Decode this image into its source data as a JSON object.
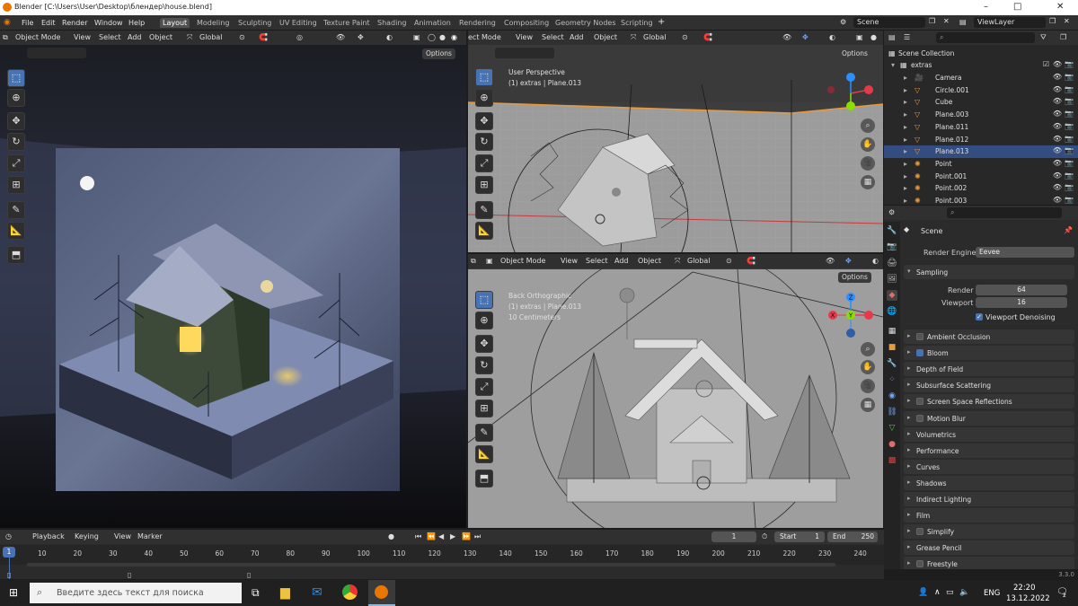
{
  "window": {
    "title": "Blender [C:\\Users\\User\\Desktop\\блендер\\house.blend]",
    "controls": [
      "–",
      "□",
      "✕"
    ]
  },
  "menu": [
    "File",
    "Edit",
    "Render",
    "Window",
    "Help"
  ],
  "workspaces": [
    "Layout",
    "Modeling",
    "Sculpting",
    "UV Editing",
    "Texture Paint",
    "Shading",
    "Animation",
    "Rendering",
    "Compositing",
    "Geometry Nodes",
    "Scripting"
  ],
  "active_workspace": "Layout",
  "scene_field": "Scene",
  "viewlayer_field": "ViewLayer",
  "viewport_menu": {
    "mode": "Object Mode",
    "items": [
      "View",
      "Select",
      "Add",
      "Object"
    ],
    "transform": "Global",
    "options": "Options"
  },
  "viewport_tr": {
    "mode_cut": "ect Mode",
    "view_name": "User Perspective",
    "collection": "(1) extras | Plane.013"
  },
  "viewport_br": {
    "view_name": "Back Orthographic",
    "collection": "(1) extras | Plane.013",
    "scale": "10 Centimeters"
  },
  "gizmo_axes": {
    "x": "X",
    "y": "Y",
    "z": "Z"
  },
  "colors": {
    "accent": "#4772b3",
    "x_axis": "#e8394b",
    "y_axis": "#8bdc00",
    "z_axis": "#2c8fff",
    "select": "#334d80",
    "object_orange": "#e89a3c",
    "data_green": "#58c452"
  },
  "outliner": {
    "root": "Scene Collection",
    "collection": "extras",
    "items": [
      {
        "name": "Camera",
        "icon": "camera-icon",
        "selected": false
      },
      {
        "name": "Circle.001",
        "icon": "mesh-icon",
        "selected": false
      },
      {
        "name": "Cube",
        "icon": "mesh-icon",
        "selected": false
      },
      {
        "name": "Plane.003",
        "icon": "mesh-icon",
        "selected": false
      },
      {
        "name": "Plane.011",
        "icon": "mesh-icon",
        "selected": false
      },
      {
        "name": "Plane.012",
        "icon": "mesh-icon",
        "selected": false
      },
      {
        "name": "Plane.013",
        "icon": "mesh-icon",
        "selected": true
      },
      {
        "name": "Point",
        "icon": "light-icon",
        "selected": false
      },
      {
        "name": "Point.001",
        "icon": "light-icon",
        "selected": false
      },
      {
        "name": "Point.002",
        "icon": "light-icon",
        "selected": false
      },
      {
        "name": "Point.003",
        "icon": "light-icon",
        "selected": false
      }
    ]
  },
  "properties": {
    "context": "Scene",
    "render_engine_label": "Render Engine",
    "render_engine_value": "Eevee",
    "sampling": {
      "title": "Sampling",
      "render_label": "Render",
      "render_value": "64",
      "viewport_label": "Viewport",
      "viewport_value": "16",
      "denoise_label": "Viewport Denoising",
      "denoise_on": true
    },
    "panels": [
      {
        "name": "Ambient Occlusion",
        "checkbox": true,
        "on": false
      },
      {
        "name": "Bloom",
        "checkbox": true,
        "on": true
      },
      {
        "name": "Depth of Field",
        "checkbox": false,
        "on": false
      },
      {
        "name": "Subsurface Scattering",
        "checkbox": false,
        "on": false
      },
      {
        "name": "Screen Space Reflections",
        "checkbox": true,
        "on": false
      },
      {
        "name": "Motion Blur",
        "checkbox": true,
        "on": false
      },
      {
        "name": "Volumetrics",
        "checkbox": false,
        "on": false
      },
      {
        "name": "Performance",
        "checkbox": false,
        "on": false
      },
      {
        "name": "Curves",
        "checkbox": false,
        "on": false
      },
      {
        "name": "Shadows",
        "checkbox": false,
        "on": false
      },
      {
        "name": "Indirect Lighting",
        "checkbox": false,
        "on": false
      },
      {
        "name": "Film",
        "checkbox": false,
        "on": false
      },
      {
        "name": "Simplify",
        "checkbox": true,
        "on": false
      },
      {
        "name": "Grease Pencil",
        "checkbox": false,
        "on": false
      },
      {
        "name": "Freestyle",
        "checkbox": true,
        "on": false
      }
    ]
  },
  "timeline": {
    "menu": [
      "Playback",
      "Keying",
      "View",
      "Marker"
    ],
    "current_frame": "1",
    "start_label": "Start",
    "start_value": "1",
    "end_label": "End",
    "end_value": "250",
    "playhead": "1",
    "ticks": [
      "10",
      "20",
      "30",
      "40",
      "50",
      "60",
      "70",
      "80",
      "90",
      "100",
      "110",
      "120",
      "130",
      "140",
      "150",
      "160",
      "170",
      "180",
      "190",
      "200",
      "210",
      "220",
      "230",
      "240"
    ]
  },
  "version": "3.3.0",
  "taskbar": {
    "search_placeholder": "Введите здесь текст для поиска",
    "language": "ENG",
    "time": "22:20",
    "date": "13.12.2022",
    "notifications": "2"
  }
}
